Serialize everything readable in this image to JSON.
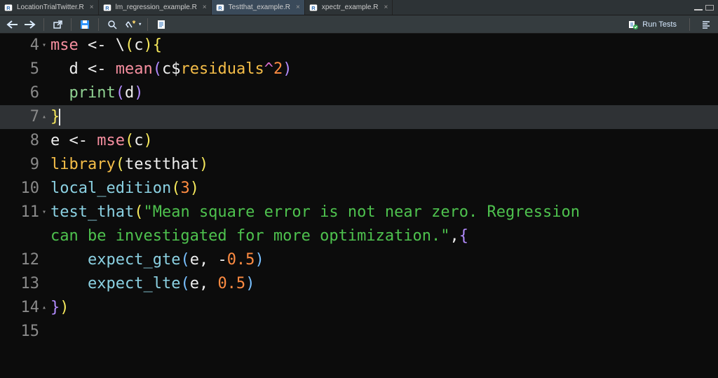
{
  "tabs": [
    {
      "label": "LocationTrialTwitter.R",
      "active": false
    },
    {
      "label": "lm_regression_example.R",
      "active": false
    },
    {
      "label": "Testthat_example.R",
      "active": true
    },
    {
      "label": "xpectr_example.R",
      "active": false
    }
  ],
  "toolbar": {
    "runTests": "Run Tests"
  },
  "editor": {
    "lines": [
      {
        "num": "4"
      },
      {
        "num": "5"
      },
      {
        "num": "6"
      },
      {
        "num": "7"
      },
      {
        "num": "8"
      },
      {
        "num": "9"
      },
      {
        "num": "10"
      },
      {
        "num": "11"
      },
      {
        "num": "12"
      },
      {
        "num": "13"
      },
      {
        "num": "14"
      },
      {
        "num": "15"
      }
    ]
  },
  "code": {
    "l4": {
      "mse": "mse",
      "arrow": "<-",
      "bs": "\\",
      "lp": "(",
      "c": "c",
      "rp": ")",
      "lb": "{"
    },
    "l5": {
      "d": "d",
      "arrow": "<-",
      "mean": "mean",
      "lp": "(",
      "c": "c",
      "dollar": "$",
      "residuals": "residuals",
      "caret": "^",
      "two": "2",
      "rp": ")"
    },
    "l6": {
      "print": "print",
      "lp": "(",
      "d": "d",
      "rp": ")"
    },
    "l7": {
      "rb": "}"
    },
    "l8": {
      "e": "e",
      "arrow": "<-",
      "mse": "mse",
      "lp": "(",
      "c": "c",
      "rp": ")"
    },
    "l9": {
      "library": "library",
      "lp": "(",
      "testthat": "testthat",
      "rp": ")"
    },
    "l10": {
      "local_edition": "local_edition",
      "lp": "(",
      "three": "3",
      "rp": ")"
    },
    "l11a": {
      "test_that": "test_that",
      "lp": "(",
      "str1": "\"Mean square error is not near zero. Regression "
    },
    "l11b": {
      "str2": "can be investigated for more optimization.\"",
      "comma": ",",
      "lb": "{"
    },
    "l12": {
      "expect_gte": "expect_gte",
      "lp": "(",
      "e": "e",
      "comma": ", ",
      "neg": "-",
      "val": "0.5",
      "rp": ")"
    },
    "l13": {
      "expect_lte": "expect_lte",
      "lp": "(",
      "e": "e",
      "comma": ", ",
      "val": "0.5",
      "rp": ")"
    },
    "l14": {
      "rb": "}",
      "rp": ")"
    }
  }
}
